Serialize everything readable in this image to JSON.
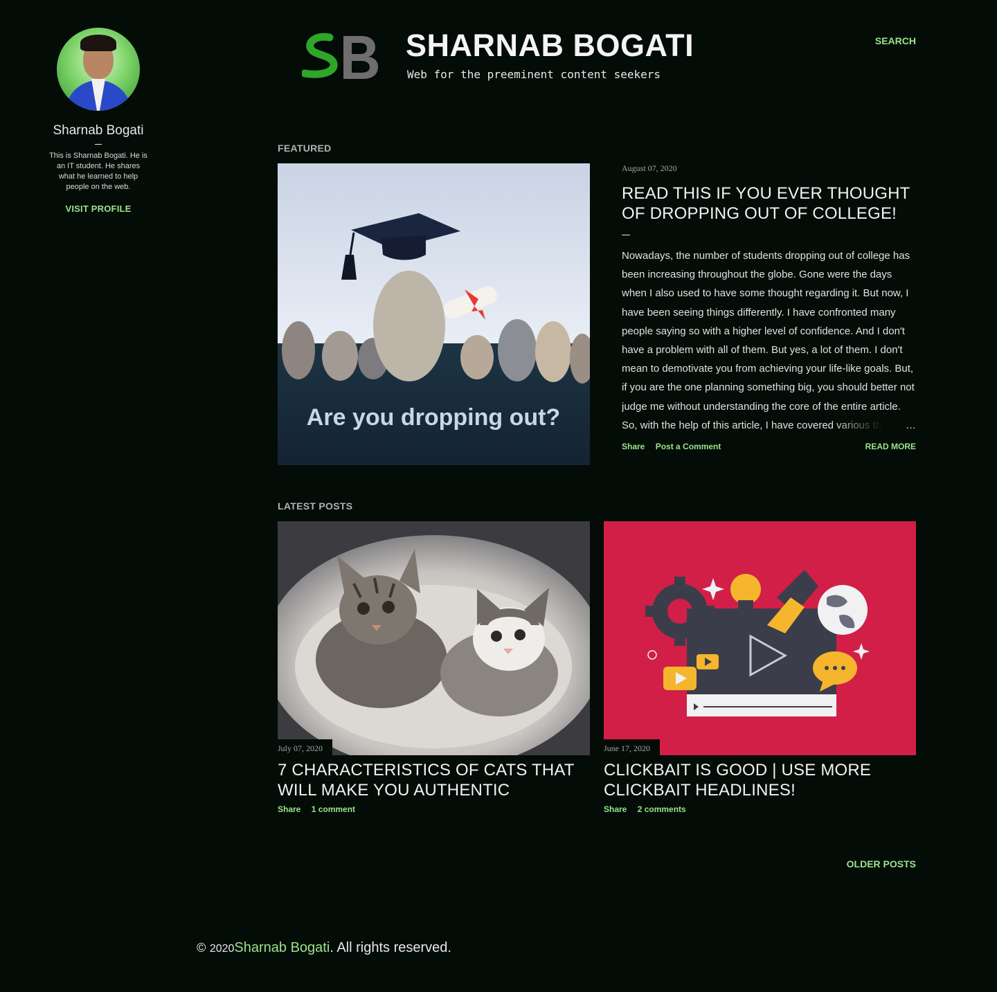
{
  "profile": {
    "name": "Sharnab Bogati",
    "bio": "This is Sharnab Bogati. He is an IT student. He shares what he learned to help people on the web.",
    "visit_label": "VISIT PROFILE"
  },
  "header": {
    "logo_mark": "SB",
    "site_title": "SHARNAB BOGATI",
    "tagline": "Web for the preeminent content seekers",
    "search_label": "SEARCH"
  },
  "featured": {
    "section_label": "FEATURED",
    "image_text": "Are you dropping out?",
    "date": "August 07, 2020",
    "title": "READ THIS IF YOU EVER THOUGHT OF DROPPING OUT OF COLLEGE!",
    "snippet": "Nowadays, the number of students dropping out of college has been increasing throughout the globe. Gone were the days when I also used to have some thought regarding it. But now, I have been seeing things differently. I have confronted many people saying so with a higher level of confidence. And I don't have a problem with all of them. But yes, a lot of them. I don't mean to demotivate you from achieving your life-like goals. But, if you are the one planning something big, you should better not judge me without understanding the core of the entire article. So, with the help of this article, I have covered various things regarding dropping out of college and also",
    "ellipsis": "…",
    "share_label": "Share",
    "comment_label": "Post a Comment",
    "read_more_label": "READ MORE"
  },
  "latest": {
    "section_label": "LATEST POSTS",
    "posts": [
      {
        "date": "July 07, 2020",
        "title": "7 CHARACTERISTICS OF CATS THAT WILL MAKE YOU AUTHENTIC",
        "share_label": "Share",
        "comment_label": "1 comment"
      },
      {
        "date": "June 17, 2020",
        "title": "CLICKBAIT IS GOOD | USE MORE CLICKBAIT HEADLINES!",
        "share_label": "Share",
        "comment_label": "2 comments"
      }
    ],
    "older_posts_label": "OLDER POSTS"
  },
  "footer": {
    "copyright_symbol": "©",
    "year": "2020",
    "owner": "Sharnab Bogati",
    "rights": ". All rights reserved."
  },
  "colors": {
    "background": "#030c07",
    "accent": "#9be58a",
    "clickbait_bg": "#d21f47"
  }
}
